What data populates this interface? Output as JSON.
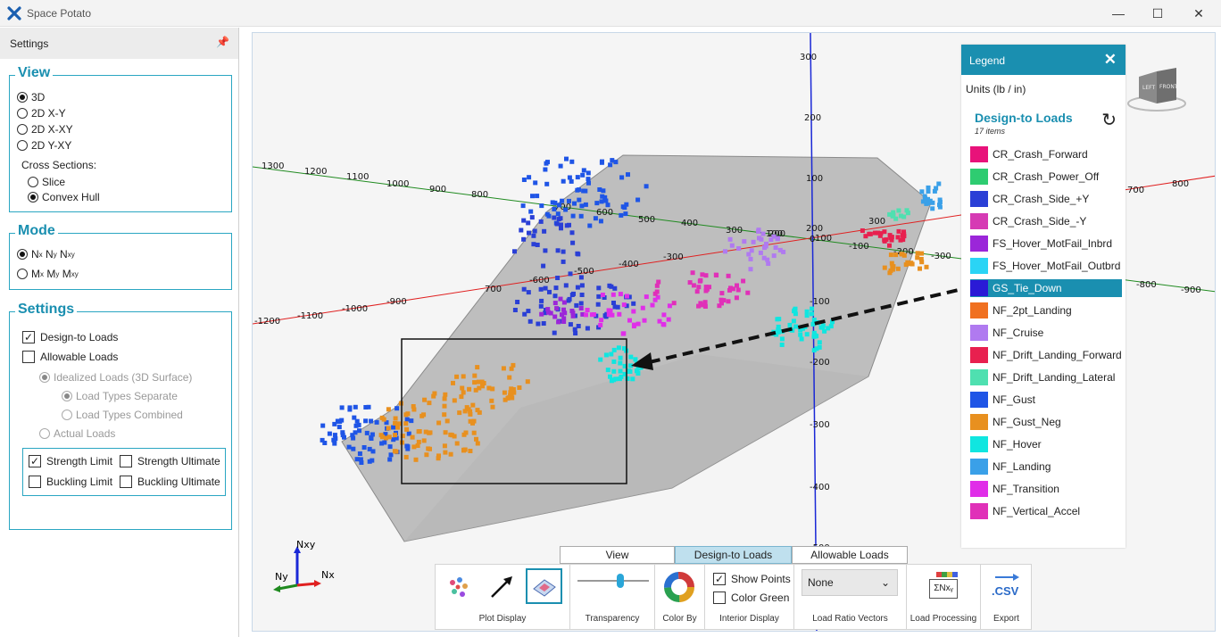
{
  "window": {
    "title": "Space Potato",
    "minimize": "—",
    "maximize": "☐",
    "close": "✕"
  },
  "settings_panel": {
    "title": "Settings",
    "view": {
      "title": "View",
      "options": [
        "3D",
        "2D X-Y",
        "2D X-XY",
        "2D Y-XY"
      ],
      "cross_sections_label": "Cross Sections:",
      "cross_sections": [
        "Slice",
        "Convex Hull"
      ]
    },
    "mode": {
      "title": "Mode",
      "force_n": "N",
      "force_x": "x",
      "force_y": "y",
      "force_xy": "xy",
      "moment_m": "M"
    },
    "settings": {
      "title": "Settings",
      "design_to_loads": "Design-to Loads",
      "allowable_loads": "Allowable Loads",
      "idealized_loads": "Idealized Loads (3D Surface)",
      "load_types_separate": "Load Types Separate",
      "load_types_combined": "Load Types Combined",
      "actual_loads": "Actual Loads",
      "strength_limit": "Strength Limit",
      "strength_ultimate": "Strength Ultimate",
      "buckling_limit": "Buckling Limit",
      "buckling_ultimate": "Buckling Ultimate"
    }
  },
  "legend": {
    "title": "Legend",
    "units": "Units (lb / in)",
    "section": "Design-to Loads",
    "count": "17 items",
    "items": [
      {
        "label": "CR_Crash_Forward",
        "color": "#e8127a"
      },
      {
        "label": "CR_Crash_Power_Off",
        "color": "#2ecc71"
      },
      {
        "label": "CR_Crash_Side_+Y",
        "color": "#2a3fd6"
      },
      {
        "label": "CR_Crash_Side_-Y",
        "color": "#d63ab4"
      },
      {
        "label": "FS_Hover_MotFail_Inbrd",
        "color": "#9b26d9"
      },
      {
        "label": "FS_Hover_MotFail_Outbrd",
        "color": "#2ad4f5"
      },
      {
        "label": "GS_Tie_Down",
        "color": "#2a1ad6"
      },
      {
        "label": "NF_2pt_Landing",
        "color": "#f07020"
      },
      {
        "label": "NF_Cruise",
        "color": "#b07af0"
      },
      {
        "label": "NF_Drift_Landing_Forward",
        "color": "#e8204f"
      },
      {
        "label": "NF_Drift_Landing_Lateral",
        "color": "#4fe0b0"
      },
      {
        "label": "NF_Gust",
        "color": "#1f55e6"
      },
      {
        "label": "NF_Gust_Neg",
        "color": "#e8901f"
      },
      {
        "label": "NF_Hover",
        "color": "#10e6e0"
      },
      {
        "label": "NF_Landing",
        "color": "#3aa0e8"
      },
      {
        "label": "NF_Transition",
        "color": "#e02ee8"
      },
      {
        "label": "NF_Vertical_Accel",
        "color": "#e030b8"
      }
    ]
  },
  "plot": {
    "x_axis_ticks": [
      "1300",
      "1200",
      "1100",
      "1000",
      "900",
      "800",
      "700",
      "600",
      "500",
      "400",
      "300",
      "200",
      "100",
      "-100",
      "-200",
      "-300",
      "-800",
      "-900"
    ],
    "y_axis_ticks": [
      "-1200",
      "-1100",
      "-1000",
      "-900",
      "700",
      "-600",
      "-500",
      "-400",
      "-300",
      "100",
      "200",
      "300",
      "700",
      "800"
    ],
    "z_axis_ticks": [
      "300",
      "200",
      "100",
      "0",
      "-100",
      "-200",
      "-300",
      "-400",
      "-500"
    ],
    "gizmo": {
      "nxy": "Nxy",
      "ny": "Ny",
      "nx": "Nx"
    },
    "view_cube": {
      "left": "LEFT",
      "front": "FRONT"
    }
  },
  "tabs": [
    "View",
    "Design-to Loads",
    "Allowable Loads"
  ],
  "toolbar": {
    "plot_display": "Plot Display",
    "transparency": "Transparency",
    "transparency_value": 0.6,
    "color_by": "Color By",
    "show_points": "Show Points",
    "color_green": "Color Green",
    "interior_display": "Interior Display",
    "load_ratio_value": "None",
    "load_ratio_vectors": "Load Ratio Vectors",
    "load_processing": "Load Processing",
    "load_processing_icon_text": "ΣNxᵧ",
    "export": "Export",
    "export_icon_text": ".CSV"
  }
}
